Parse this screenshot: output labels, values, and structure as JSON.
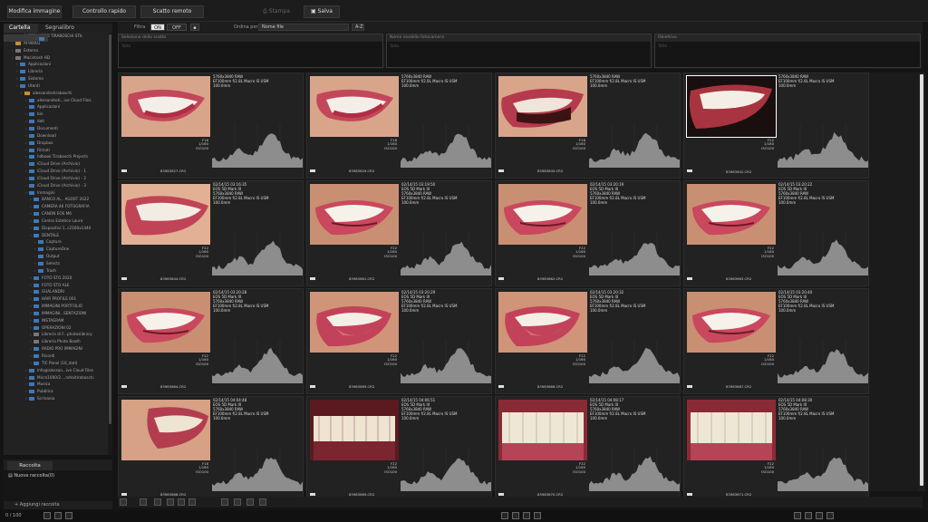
{
  "toolbar": {
    "modifica": "Modifica immagine",
    "controllo": "Controllo rapido",
    "scatto": "Scatto remoto",
    "stampa": "Stampa",
    "salva": "Salva"
  },
  "sidebar": {
    "tab_folder": "Cartella",
    "tab_bookmark": "Segnalibro",
    "items": [
      {
        "label": "ALESSANDRO TIRABOSCHI STb",
        "depth": 1,
        "icon": "gold"
      },
      {
        "label": "AT90001",
        "depth": 1,
        "icon": "gold"
      },
      {
        "label": "Esterno",
        "depth": 1,
        "icon": "gray"
      },
      {
        "label": "Macintosh HD",
        "depth": 1,
        "icon": "gray"
      },
      {
        "label": "Applicazioni",
        "depth": 2,
        "icon": "blue"
      },
      {
        "label": "Libreria",
        "depth": 2,
        "icon": "blue"
      },
      {
        "label": "Sistema",
        "depth": 2,
        "icon": "blue"
      },
      {
        "label": "Utenti",
        "depth": 2,
        "icon": "blue"
      },
      {
        "label": "alessandrotiraboschi",
        "depth": 3,
        "icon": "gold"
      },
      {
        "label": "alessandroti...ive Cloud Files",
        "depth": 4,
        "icon": "blue"
      },
      {
        "label": "Applicazioni",
        "depth": 4,
        "icon": "blue"
      },
      {
        "label": "bin",
        "depth": 4,
        "icon": "blue"
      },
      {
        "label": "dati",
        "depth": 4,
        "icon": "blue"
      },
      {
        "label": "Documenti",
        "depth": 4,
        "icon": "blue"
      },
      {
        "label": "Download",
        "depth": 4,
        "icon": "blue"
      },
      {
        "label": "Dropbox",
        "depth": 4,
        "icon": "blue"
      },
      {
        "label": "Filmati",
        "depth": 4,
        "icon": "blue"
      },
      {
        "label": "hdbook Tiraboschi Projects",
        "depth": 4,
        "icon": "blue"
      },
      {
        "label": "iCloud Drive (Archivio)",
        "depth": 4,
        "icon": "blue"
      },
      {
        "label": "iCloud Drive (Archivio) - 1",
        "depth": 4,
        "icon": "blue"
      },
      {
        "label": "iCloud Drive (Archivio) - 2",
        "depth": 4,
        "icon": "blue"
      },
      {
        "label": "iCloud Drive (Archivio) - 3",
        "depth": 4,
        "icon": "blue"
      },
      {
        "label": "Immagini",
        "depth": 4,
        "icon": "blue"
      },
      {
        "label": "BANCO AL.. AGOST 2022",
        "depth": 5,
        "icon": "blue"
      },
      {
        "label": "CAMERA 4K FOTOGRAFIA",
        "depth": 5,
        "icon": "blue"
      },
      {
        "label": "CANON EOS M6",
        "depth": 5,
        "icon": "blue"
      },
      {
        "label": "Centro Estetico Laura",
        "depth": 5,
        "icon": "blue"
      },
      {
        "label": "Dispositivi 1..c2160x1440",
        "depth": 5,
        "icon": "blue"
      },
      {
        "label": "DENTALE",
        "depth": 5,
        "icon": "blue"
      },
      {
        "label": "Capture",
        "depth": 6,
        "icon": "blue"
      },
      {
        "label": "CaptureOne",
        "depth": 6,
        "icon": "blue"
      },
      {
        "label": "Output",
        "depth": 6,
        "icon": "blue"
      },
      {
        "label": "",
        "depth": 6,
        "icon": "blue",
        "selected": true
      },
      {
        "label": "Selects",
        "depth": 6,
        "icon": "blue"
      },
      {
        "label": "Trash",
        "depth": 6,
        "icon": "blue"
      },
      {
        "label": "FOTO STO 2020",
        "depth": 5,
        "icon": "blue"
      },
      {
        "label": "FOTO STO ALE",
        "depth": 5,
        "icon": "blue"
      },
      {
        "label": "GUALANDRI",
        "depth": 5,
        "icon": "blue"
      },
      {
        "label": "HAIR PROFILE 001",
        "depth": 5,
        "icon": "blue"
      },
      {
        "label": "IMMAGINI PORTFOLIO",
        "depth": 5,
        "icon": "blue"
      },
      {
        "label": "IMMAGINI...SENTAZIONI",
        "depth": 5,
        "icon": "blue"
      },
      {
        "label": "INSTAGRAM",
        "depth": 5,
        "icon": "blue"
      },
      {
        "label": "OPERAZIONI 02",
        "depth": 5,
        "icon": "blue"
      },
      {
        "label": "Libreria di F...photoslibrary",
        "depth": 5,
        "icon": "gray"
      },
      {
        "label": "Libreria Photo Booth",
        "depth": 5,
        "icon": "gray"
      },
      {
        "label": "RADIO PRO IMMAGINI",
        "depth": 5,
        "icon": "blue"
      },
      {
        "label": "Ricordi",
        "depth": 5,
        "icon": "blue"
      },
      {
        "label": "TIC Panel (16_dati)",
        "depth": 5,
        "icon": "blue"
      },
      {
        "label": "Info@alessan...ive Cloud Files",
        "depth": 4,
        "icon": "blue"
      },
      {
        "label": "Micro1000/2....ndroitiraboschi",
        "depth": 4,
        "icon": "blue"
      },
      {
        "label": "Musica",
        "depth": 4,
        "icon": "blue"
      },
      {
        "label": "Pubblica",
        "depth": 4,
        "icon": "blue"
      },
      {
        "label": "Scrivania",
        "depth": 4,
        "icon": "blue"
      }
    ]
  },
  "raccolta": {
    "tab": "Raccolta",
    "item": "Nuova raccolta(0)",
    "add": "Aggiungi raccolta"
  },
  "filterbar": {
    "filtra": "Filtra",
    "on": "ON",
    "off": "OFF",
    "ordine_label": "Ordina per",
    "ordine_value": "Nome file",
    "sort_dir": "A-Z"
  },
  "panels": [
    {
      "title": "Selezione dello scatto",
      "sub": "Tutto"
    },
    {
      "title": "Nome modello fotocamera",
      "sub": "Tutto"
    },
    {
      "title": "Obiettivo",
      "sub": "Tutto"
    }
  ],
  "grid": {
    "items": [
      {
        "date": "",
        "model": "",
        "size": "5760x3840 RAW",
        "lens": "EF100mm f/2.8L Macro IS USM",
        "focal": "100.0mm",
        "f": "F16",
        "shutter": "1/160",
        "iso": "ISO100",
        "file": "83983627.CR2",
        "scene": 1
      },
      {
        "date": "",
        "model": "",
        "size": "5760x3840 RAW",
        "lens": "EF100mm f/2.8L Macro IS USM",
        "focal": "100.0mm",
        "f": "F16",
        "shutter": "1/160",
        "iso": "ISO100",
        "file": "83983629.CR2",
        "scene": 1
      },
      {
        "date": "",
        "model": "",
        "size": "5760x3840 RAW",
        "lens": "EF100mm f/2.8L Macro IS USM",
        "focal": "100.0mm",
        "f": "F16",
        "shutter": "1/160",
        "iso": "ISO100",
        "file": "83983640.CR2",
        "scene": 2
      },
      {
        "date": "",
        "model": "",
        "size": "5760x3840 RAW",
        "lens": "EF100mm f/2.8L Macro IS USM",
        "focal": "100.0mm",
        "f": "F22",
        "shutter": "1/160",
        "iso": "ISO100",
        "file": "83983642.CR2",
        "scene": 3,
        "selected": true
      },
      {
        "date": "02/14/15 03:16:35",
        "model": "EOS 5D Mark III",
        "size": "5760x3840 RAW",
        "lens": "EF100mm f/2.8L Macro IS USM",
        "focal": "100.0mm",
        "f": "F22",
        "shutter": "1/160",
        "iso": "ISO100",
        "file": "83983644.CR2",
        "scene": 4
      },
      {
        "date": "02/14/15 03:19:50",
        "model": "EOS 5D Mark III",
        "size": "5760x3840 RAW",
        "lens": "EF100mm f/2.8L Macro IS USM",
        "focal": "100.0mm",
        "f": "F22",
        "shutter": "1/160",
        "iso": "ISO100",
        "file": "83983661.CR2",
        "scene": 5
      },
      {
        "date": "02/14/15 03:20:19",
        "model": "EOS 5D Mark III",
        "size": "5760x3840 RAW",
        "lens": "EF100mm f/2.8L Macro IS USM",
        "focal": "100.0mm",
        "f": "F22",
        "shutter": "1/160",
        "iso": "ISO100",
        "file": "83983662.CR2",
        "scene": 5
      },
      {
        "date": "02/14/15 03:20:22",
        "model": "EOS 5D Mark III",
        "size": "5760x3840 RAW",
        "lens": "EF100mm f/2.8L Macro IS USM",
        "focal": "100.0mm",
        "f": "F22",
        "shutter": "1/160",
        "iso": "ISO100",
        "file": "83983663.CR2",
        "scene": 5
      },
      {
        "date": "02/14/15 03:20:28",
        "model": "EOS 5D Mark III",
        "size": "5760x3840 RAW",
        "lens": "EF100mm f/2.8L Macro IS USM",
        "focal": "100.0mm",
        "f": "F22",
        "shutter": "1/160",
        "iso": "ISO100",
        "file": "83983664.CR2",
        "scene": 5
      },
      {
        "date": "02/14/15 03:20:29",
        "model": "EOS 5D Mark III",
        "size": "5760x3840 RAW",
        "lens": "EF100mm f/2.8L Macro IS USM",
        "focal": "100.0mm",
        "f": "F22",
        "shutter": "1/160",
        "iso": "ISO100",
        "file": "83983665.CR2",
        "scene": 6
      },
      {
        "date": "02/14/15 03:20:32",
        "model": "EOS 5D Mark III",
        "size": "5760x3840 RAW",
        "lens": "EF100mm f/2.8L Macro IS USM",
        "focal": "100.0mm",
        "f": "F22",
        "shutter": "1/160",
        "iso": "ISO100",
        "file": "83983666.CR2",
        "scene": 6
      },
      {
        "date": "02/14/15 03:20:40",
        "model": "EOS 5D Mark III",
        "size": "5760x3840 RAW",
        "lens": "EF100mm f/2.8L Macro IS USM",
        "focal": "100.0mm",
        "f": "F22",
        "shutter": "1/160",
        "iso": "ISO100",
        "file": "83983667.CR2",
        "scene": 5
      },
      {
        "date": "02/14/15 04:04:48",
        "model": "EOS 5D Mark III",
        "size": "5760x3840 RAW",
        "lens": "EF100mm f/2.8L Macro IS USM",
        "focal": "100.0mm",
        "f": "F16",
        "shutter": "1/160",
        "iso": "ISO100",
        "file": "83983668.CR2",
        "scene": 7
      },
      {
        "date": "02/14/15 04:06:51",
        "model": "EOS 5D Mark III",
        "size": "5760x3840 RAW",
        "lens": "EF100mm f/2.8L Macro IS USM",
        "focal": "100.0mm",
        "f": "F22",
        "shutter": "1/160",
        "iso": "ISO100",
        "file": "83983669.CR2",
        "scene": 8
      },
      {
        "date": "02/14/15 04:08:17",
        "model": "EOS 5D Mark III",
        "size": "5760x3840 RAW",
        "lens": "EF100mm f/2.8L Macro IS USM",
        "focal": "100.0mm",
        "f": "F22",
        "shutter": "1/160",
        "iso": "ISO100",
        "file": "83983670.CR2",
        "scene": 9
      },
      {
        "date": "02/14/15 04:08:30",
        "model": "EOS 5D Mark III",
        "size": "5760x3840 RAW",
        "lens": "EF100mm f/2.8L Macro IS USM",
        "focal": "100.0mm",
        "f": "F22",
        "shutter": "1/160",
        "iso": "ISO100",
        "file": "83983671.CR2",
        "scene": 9
      }
    ]
  },
  "status": {
    "count": "0 / 100"
  },
  "colors": {
    "accent": "#3d79b8",
    "folder": "#c98e2e",
    "bg": "#141414",
    "panel_white": "#ffffff"
  }
}
